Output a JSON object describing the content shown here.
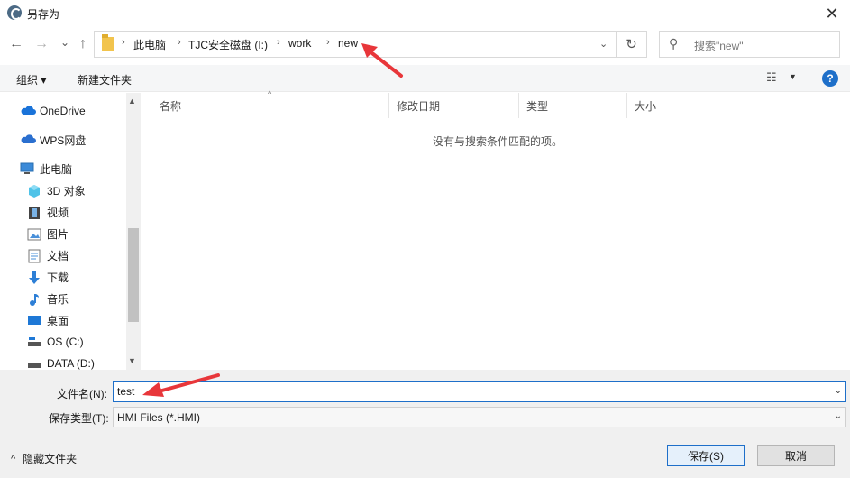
{
  "window": {
    "title": "另存为",
    "close": "✕"
  },
  "nav": {
    "back": "←",
    "forward": "→",
    "recent": "⌄",
    "up": "↑"
  },
  "address": {
    "crumbs": [
      "此电脑",
      "TJC安全磁盘 (I:)",
      "work",
      "new"
    ],
    "separator": "›"
  },
  "search": {
    "placeholder": "搜索\"new\""
  },
  "toolbar": {
    "organize": "组织 ▾",
    "new_folder": "新建文件夹"
  },
  "sidebar": {
    "items": [
      {
        "label": "OneDrive",
        "icon": "cloud-icon"
      },
      {
        "label": "WPS网盘",
        "icon": "cloud-icon"
      },
      {
        "label": "此电脑",
        "icon": "computer-icon"
      },
      {
        "label": "3D 对象",
        "icon": "cube-icon"
      },
      {
        "label": "视频",
        "icon": "film-icon"
      },
      {
        "label": "图片",
        "icon": "picture-icon"
      },
      {
        "label": "文档",
        "icon": "document-icon"
      },
      {
        "label": "下载",
        "icon": "download-icon"
      },
      {
        "label": "音乐",
        "icon": "music-icon"
      },
      {
        "label": "桌面",
        "icon": "desktop-icon"
      },
      {
        "label": "OS (C:)",
        "icon": "drive-icon"
      },
      {
        "label": "DATA (D:)",
        "icon": "drive-icon"
      }
    ]
  },
  "filelist": {
    "columns": [
      "名称",
      "修改日期",
      "类型",
      "大小"
    ],
    "empty_message": "没有与搜索条件匹配的项。"
  },
  "form": {
    "filename_label": "文件名(N):",
    "filename_value": "test",
    "filetype_label": "保存类型(T):",
    "filetype_value": "HMI Files (*.HMI)"
  },
  "footer": {
    "hide_folders": "隐藏文件夹",
    "save": "保存(S)",
    "cancel": "取消"
  },
  "colors": {
    "accent": "#1e6fc9",
    "annotation": "#e8363a"
  }
}
